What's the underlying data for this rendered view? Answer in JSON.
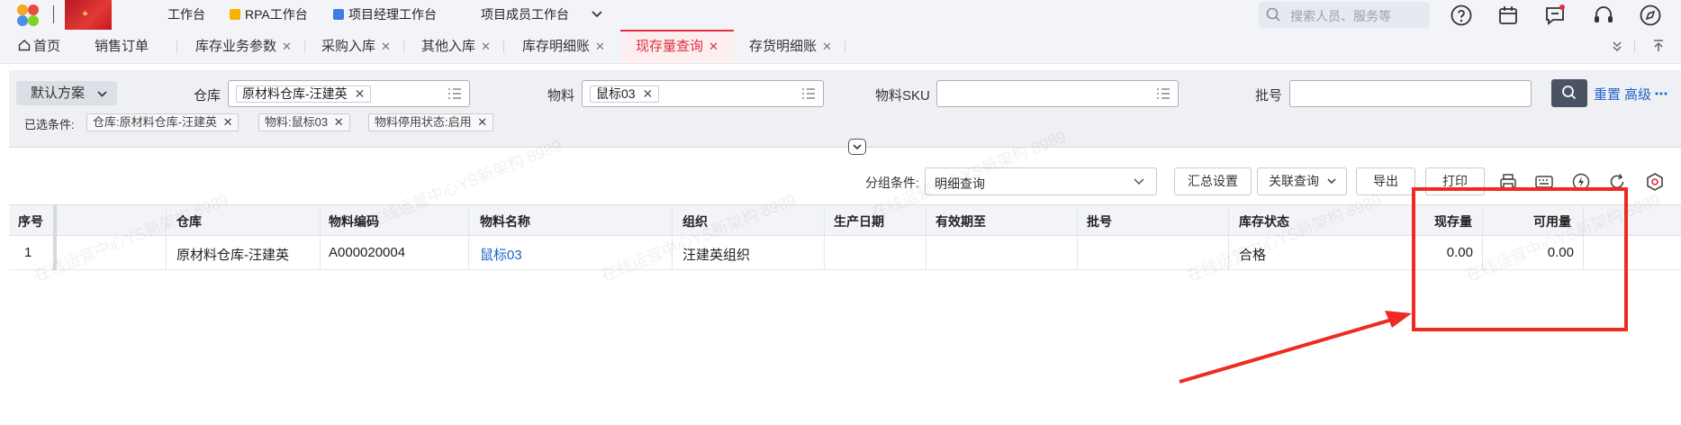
{
  "topbar": {
    "nav": [
      {
        "label": "工作台"
      },
      {
        "label": "RPA工作台"
      },
      {
        "label": "项目经理工作台"
      },
      {
        "label": "项目成员工作台"
      }
    ],
    "search_placeholder": "搜索人员、服务等"
  },
  "tabs": {
    "home": "首页",
    "items": [
      {
        "label": "销售订单",
        "closable": false
      },
      {
        "label": "库存业务参数",
        "closable": true
      },
      {
        "label": "采购入库",
        "closable": true
      },
      {
        "label": "其他入库",
        "closable": true
      },
      {
        "label": "库存明细账",
        "closable": true
      },
      {
        "label": "现存量查询",
        "closable": true,
        "active": true
      },
      {
        "label": "存货明细账",
        "closable": true
      }
    ]
  },
  "filter": {
    "scheme": "默认方案",
    "warehouse_label": "仓库",
    "warehouse_value": "原材料仓库-汪建英",
    "material_label": "物料",
    "material_value": "鼠标03",
    "sku_label": "物料SKU",
    "batch_label": "批号",
    "reset": "重置",
    "advanced": "高级",
    "selected_label": "已选条件:",
    "selected": [
      "仓库:原材料仓库-汪建英",
      "物料:鼠标03",
      "物料停用状态:启用"
    ]
  },
  "toolbar": {
    "group_label": "分组条件:",
    "group_value": "明细查询",
    "summary_button": "汇总设置",
    "related_button": "关联查询",
    "export_button": "导出",
    "print_button": "打印"
  },
  "table": {
    "headers": [
      "序号",
      "仓库",
      "物料编码",
      "物料名称",
      "组织",
      "生产日期",
      "有效期至",
      "批号",
      "库存状态",
      "现存量",
      "可用量"
    ],
    "rows": [
      {
        "index": "1",
        "warehouse": "原材料仓库-汪建英",
        "code": "A000020004",
        "name": "鼠标03",
        "org": "汪建英组织",
        "production_date": "",
        "expiry": "",
        "batch": "",
        "status": "合格",
        "on_hand": "0.00",
        "available": "0.00"
      }
    ]
  },
  "watermark": "在线运营中心YS新架构 8989",
  "colors": {
    "accent": "#e02e3b",
    "link": "#1f63c8",
    "annotation": "#ef2a22"
  }
}
